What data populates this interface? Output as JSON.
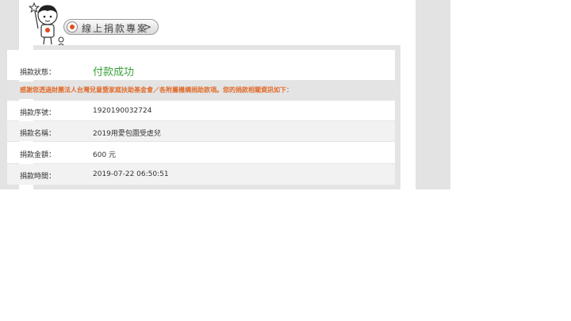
{
  "header": {
    "title_label": "線上捐款專案",
    "title_arrow": ">"
  },
  "icons": {
    "mascot": "mascot-child-star-icon",
    "pill": "record-dot-icon"
  },
  "colors": {
    "success": "#3aa23a",
    "notice": "#e06d2c",
    "pill_dot": "#e04d1f"
  },
  "result": {
    "status_label": "捐款狀態：",
    "status_value": "付款成功",
    "notice": "感謝您透過財團法人台灣兒童暨家庭扶助基金會／各附屬機構捐助款項。您的捐款相關資訊如下：",
    "serial_label": "捐款序號：",
    "serial_value": "1920190032724",
    "name_label": "捐款名稱：",
    "name_value": "2019用愛包圍受虐兒",
    "amount_label": "捐款金額：",
    "amount_value": "600 元",
    "time_label": "捐款時間：",
    "time_value": "2019-07-22 06:50:51"
  }
}
